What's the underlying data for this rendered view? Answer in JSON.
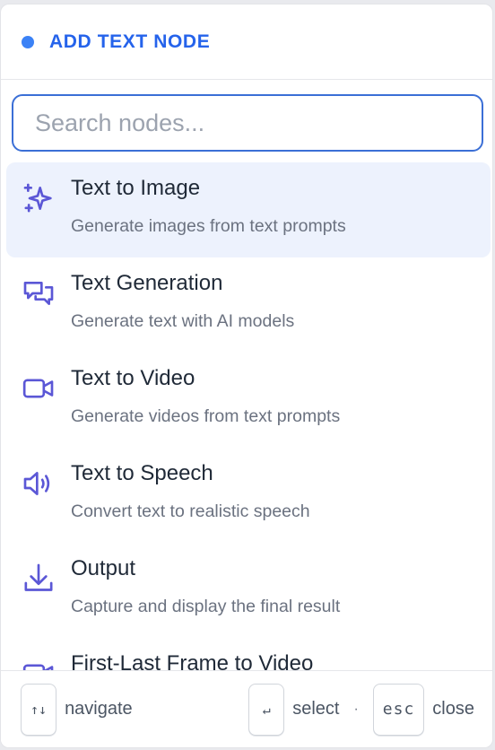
{
  "header": {
    "title": "ADD TEXT NODE",
    "dot_color": "#3b82f6"
  },
  "search": {
    "placeholder": "Search nodes...",
    "value": ""
  },
  "items": [
    {
      "name": "Text to Image",
      "desc": "Generate images from text prompts",
      "icon": "sparkles-icon",
      "active": true
    },
    {
      "name": "Text Generation",
      "desc": "Generate text with AI models",
      "icon": "chat-bubbles-icon",
      "active": false
    },
    {
      "name": "Text to Video",
      "desc": "Generate videos from text prompts",
      "icon": "video-camera-icon",
      "active": false
    },
    {
      "name": "Text to Speech",
      "desc": "Convert text to realistic speech",
      "icon": "speaker-icon",
      "active": false
    },
    {
      "name": "Output",
      "desc": "Capture and display the final result",
      "icon": "download-icon",
      "active": false
    },
    {
      "name": "First-Last Frame to Video",
      "desc": "",
      "icon": "video-camera-icon",
      "active": false
    }
  ],
  "footer": {
    "navigate_key": "↑↓",
    "navigate_label": "navigate",
    "select_key": "↵",
    "select_label": "select",
    "separator": "·",
    "close_key": "esc",
    "close_label": "close"
  },
  "colors": {
    "accent": "#2563eb",
    "icon": "#5b57d6",
    "active_bg": "#edf2fd"
  }
}
